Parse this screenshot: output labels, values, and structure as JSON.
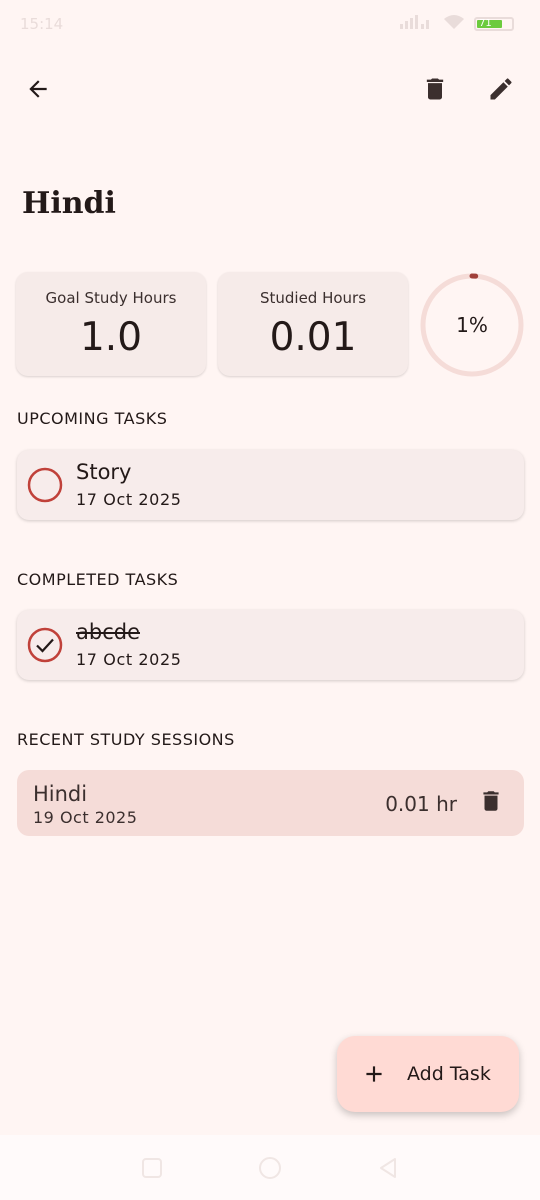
{
  "status_bar": {
    "time": "15:14",
    "battery_level": "71"
  },
  "header": {
    "back_icon": "arrow-back-icon",
    "delete_icon": "trash-icon",
    "edit_icon": "pencil-icon"
  },
  "subject": {
    "title": "Hindi"
  },
  "stats": {
    "goal_label": "Goal Study Hours",
    "goal_value": "1.0",
    "studied_label": "Studied Hours",
    "studied_value": "0.01",
    "progress_text": "1%",
    "progress_fraction": 0.01
  },
  "upcoming": {
    "heading": "UPCOMING TASKS",
    "tasks": [
      {
        "title": "Story",
        "date": "17 Oct 2025",
        "completed": false
      }
    ]
  },
  "completed": {
    "heading": "COMPLETED TASKS",
    "tasks": [
      {
        "title": "abcde",
        "date": "17 Oct 2025",
        "completed": true
      }
    ]
  },
  "sessions": {
    "heading": "RECENT STUDY SESSIONS",
    "items": [
      {
        "subject": "Hindi",
        "date": "19 Oct 2025",
        "hours": "0.01 hr"
      }
    ]
  },
  "fab": {
    "label": "Add Task",
    "icon": "plus-icon"
  },
  "colors": {
    "background": "#fff5f3",
    "accent_red": "#c0413a",
    "card": "#f7eceb",
    "session_card": "#f5dcd8",
    "fab": "#ffdad4"
  }
}
